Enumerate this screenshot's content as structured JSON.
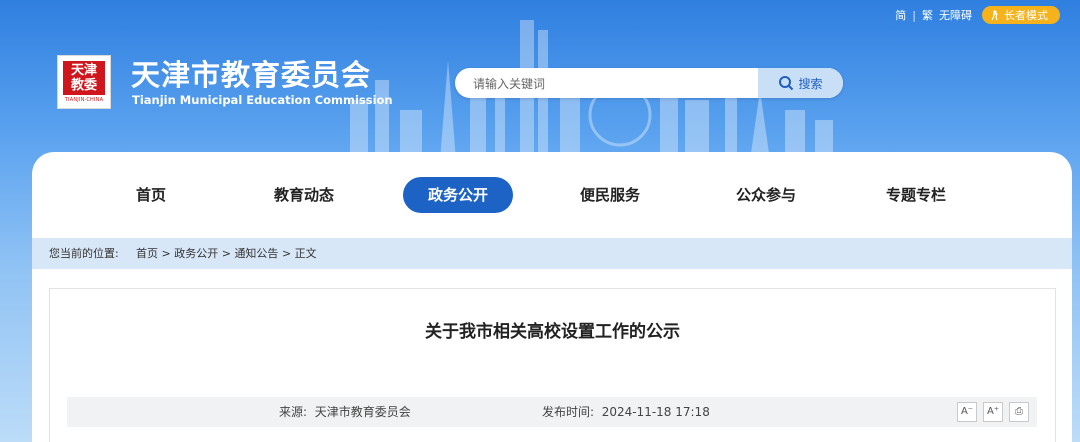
{
  "utility": {
    "simplified": "简",
    "separator": "|",
    "traditional": "繁",
    "accessibility": "无障碍",
    "elder_mode": "长者模式"
  },
  "header": {
    "logo_seal_text": "天津 教委",
    "logo_caption": "TIANJIN·CHINA",
    "title": "天津市教育委员会",
    "subtitle": "Tianjin Municipal Education Commission"
  },
  "search": {
    "placeholder": "请输入关键词",
    "button_label": "搜索"
  },
  "nav": {
    "items": [
      {
        "label": "首页",
        "active": false
      },
      {
        "label": "教育动态",
        "active": false
      },
      {
        "label": "政务公开",
        "active": true
      },
      {
        "label": "便民服务",
        "active": false
      },
      {
        "label": "公众参与",
        "active": false
      },
      {
        "label": "专题专栏",
        "active": false
      }
    ]
  },
  "breadcrumb": {
    "label": "您当前的位置:",
    "items": [
      "首页",
      "政务公开",
      "通知公告",
      "正文"
    ],
    "sep": ">"
  },
  "article": {
    "title": "关于我市相关高校设置工作的公示",
    "source_label": "来源:",
    "source": "天津市教育委员会",
    "date_label": "发布时间:",
    "date": "2024-11-18 17:18",
    "tools": [
      "A⁻",
      "A⁺",
      "⎙"
    ]
  },
  "colors": {
    "brand_blue": "#1c63c5",
    "elder_orange": "#f5b21a",
    "seal_red": "#d0161d"
  }
}
